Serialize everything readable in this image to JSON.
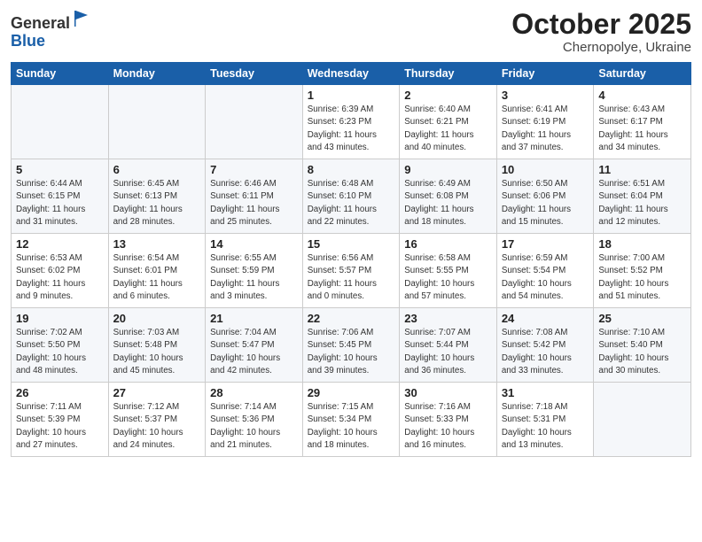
{
  "logo": {
    "general": "General",
    "blue": "Blue"
  },
  "title": "October 2025",
  "location": "Chernopolye, Ukraine",
  "days_header": [
    "Sunday",
    "Monday",
    "Tuesday",
    "Wednesday",
    "Thursday",
    "Friday",
    "Saturday"
  ],
  "weeks": [
    [
      {
        "day": "",
        "info": ""
      },
      {
        "day": "",
        "info": ""
      },
      {
        "day": "",
        "info": ""
      },
      {
        "day": "1",
        "info": "Sunrise: 6:39 AM\nSunset: 6:23 PM\nDaylight: 11 hours\nand 43 minutes."
      },
      {
        "day": "2",
        "info": "Sunrise: 6:40 AM\nSunset: 6:21 PM\nDaylight: 11 hours\nand 40 minutes."
      },
      {
        "day": "3",
        "info": "Sunrise: 6:41 AM\nSunset: 6:19 PM\nDaylight: 11 hours\nand 37 minutes."
      },
      {
        "day": "4",
        "info": "Sunrise: 6:43 AM\nSunset: 6:17 PM\nDaylight: 11 hours\nand 34 minutes."
      }
    ],
    [
      {
        "day": "5",
        "info": "Sunrise: 6:44 AM\nSunset: 6:15 PM\nDaylight: 11 hours\nand 31 minutes."
      },
      {
        "day": "6",
        "info": "Sunrise: 6:45 AM\nSunset: 6:13 PM\nDaylight: 11 hours\nand 28 minutes."
      },
      {
        "day": "7",
        "info": "Sunrise: 6:46 AM\nSunset: 6:11 PM\nDaylight: 11 hours\nand 25 minutes."
      },
      {
        "day": "8",
        "info": "Sunrise: 6:48 AM\nSunset: 6:10 PM\nDaylight: 11 hours\nand 22 minutes."
      },
      {
        "day": "9",
        "info": "Sunrise: 6:49 AM\nSunset: 6:08 PM\nDaylight: 11 hours\nand 18 minutes."
      },
      {
        "day": "10",
        "info": "Sunrise: 6:50 AM\nSunset: 6:06 PM\nDaylight: 11 hours\nand 15 minutes."
      },
      {
        "day": "11",
        "info": "Sunrise: 6:51 AM\nSunset: 6:04 PM\nDaylight: 11 hours\nand 12 minutes."
      }
    ],
    [
      {
        "day": "12",
        "info": "Sunrise: 6:53 AM\nSunset: 6:02 PM\nDaylight: 11 hours\nand 9 minutes."
      },
      {
        "day": "13",
        "info": "Sunrise: 6:54 AM\nSunset: 6:01 PM\nDaylight: 11 hours\nand 6 minutes."
      },
      {
        "day": "14",
        "info": "Sunrise: 6:55 AM\nSunset: 5:59 PM\nDaylight: 11 hours\nand 3 minutes."
      },
      {
        "day": "15",
        "info": "Sunrise: 6:56 AM\nSunset: 5:57 PM\nDaylight: 11 hours\nand 0 minutes."
      },
      {
        "day": "16",
        "info": "Sunrise: 6:58 AM\nSunset: 5:55 PM\nDaylight: 10 hours\nand 57 minutes."
      },
      {
        "day": "17",
        "info": "Sunrise: 6:59 AM\nSunset: 5:54 PM\nDaylight: 10 hours\nand 54 minutes."
      },
      {
        "day": "18",
        "info": "Sunrise: 7:00 AM\nSunset: 5:52 PM\nDaylight: 10 hours\nand 51 minutes."
      }
    ],
    [
      {
        "day": "19",
        "info": "Sunrise: 7:02 AM\nSunset: 5:50 PM\nDaylight: 10 hours\nand 48 minutes."
      },
      {
        "day": "20",
        "info": "Sunrise: 7:03 AM\nSunset: 5:48 PM\nDaylight: 10 hours\nand 45 minutes."
      },
      {
        "day": "21",
        "info": "Sunrise: 7:04 AM\nSunset: 5:47 PM\nDaylight: 10 hours\nand 42 minutes."
      },
      {
        "day": "22",
        "info": "Sunrise: 7:06 AM\nSunset: 5:45 PM\nDaylight: 10 hours\nand 39 minutes."
      },
      {
        "day": "23",
        "info": "Sunrise: 7:07 AM\nSunset: 5:44 PM\nDaylight: 10 hours\nand 36 minutes."
      },
      {
        "day": "24",
        "info": "Sunrise: 7:08 AM\nSunset: 5:42 PM\nDaylight: 10 hours\nand 33 minutes."
      },
      {
        "day": "25",
        "info": "Sunrise: 7:10 AM\nSunset: 5:40 PM\nDaylight: 10 hours\nand 30 minutes."
      }
    ],
    [
      {
        "day": "26",
        "info": "Sunrise: 7:11 AM\nSunset: 5:39 PM\nDaylight: 10 hours\nand 27 minutes."
      },
      {
        "day": "27",
        "info": "Sunrise: 7:12 AM\nSunset: 5:37 PM\nDaylight: 10 hours\nand 24 minutes."
      },
      {
        "day": "28",
        "info": "Sunrise: 7:14 AM\nSunset: 5:36 PM\nDaylight: 10 hours\nand 21 minutes."
      },
      {
        "day": "29",
        "info": "Sunrise: 7:15 AM\nSunset: 5:34 PM\nDaylight: 10 hours\nand 18 minutes."
      },
      {
        "day": "30",
        "info": "Sunrise: 7:16 AM\nSunset: 5:33 PM\nDaylight: 10 hours\nand 16 minutes."
      },
      {
        "day": "31",
        "info": "Sunrise: 7:18 AM\nSunset: 5:31 PM\nDaylight: 10 hours\nand 13 minutes."
      },
      {
        "day": "",
        "info": ""
      }
    ]
  ]
}
